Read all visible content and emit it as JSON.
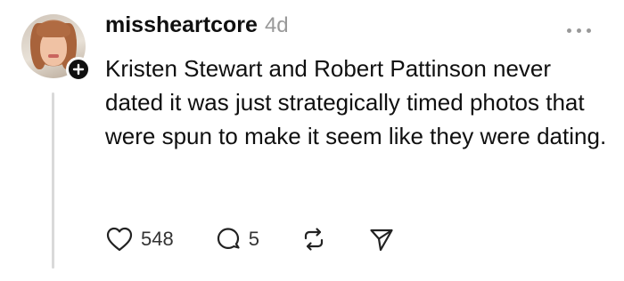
{
  "post": {
    "username": "missheartcore",
    "timestamp": "4d",
    "text": "Kristen Stewart and Robert Pattinson never dated it was just strategically timed photos that were spun to make it seem like they were dating."
  },
  "actions": {
    "likes": "548",
    "replies": "5",
    "icons": [
      "heart-icon",
      "comment-icon",
      "repost-icon",
      "share-icon"
    ]
  },
  "colors": {
    "text": "#101010",
    "muted": "#999999",
    "thread_line": "#d9d9d9"
  }
}
